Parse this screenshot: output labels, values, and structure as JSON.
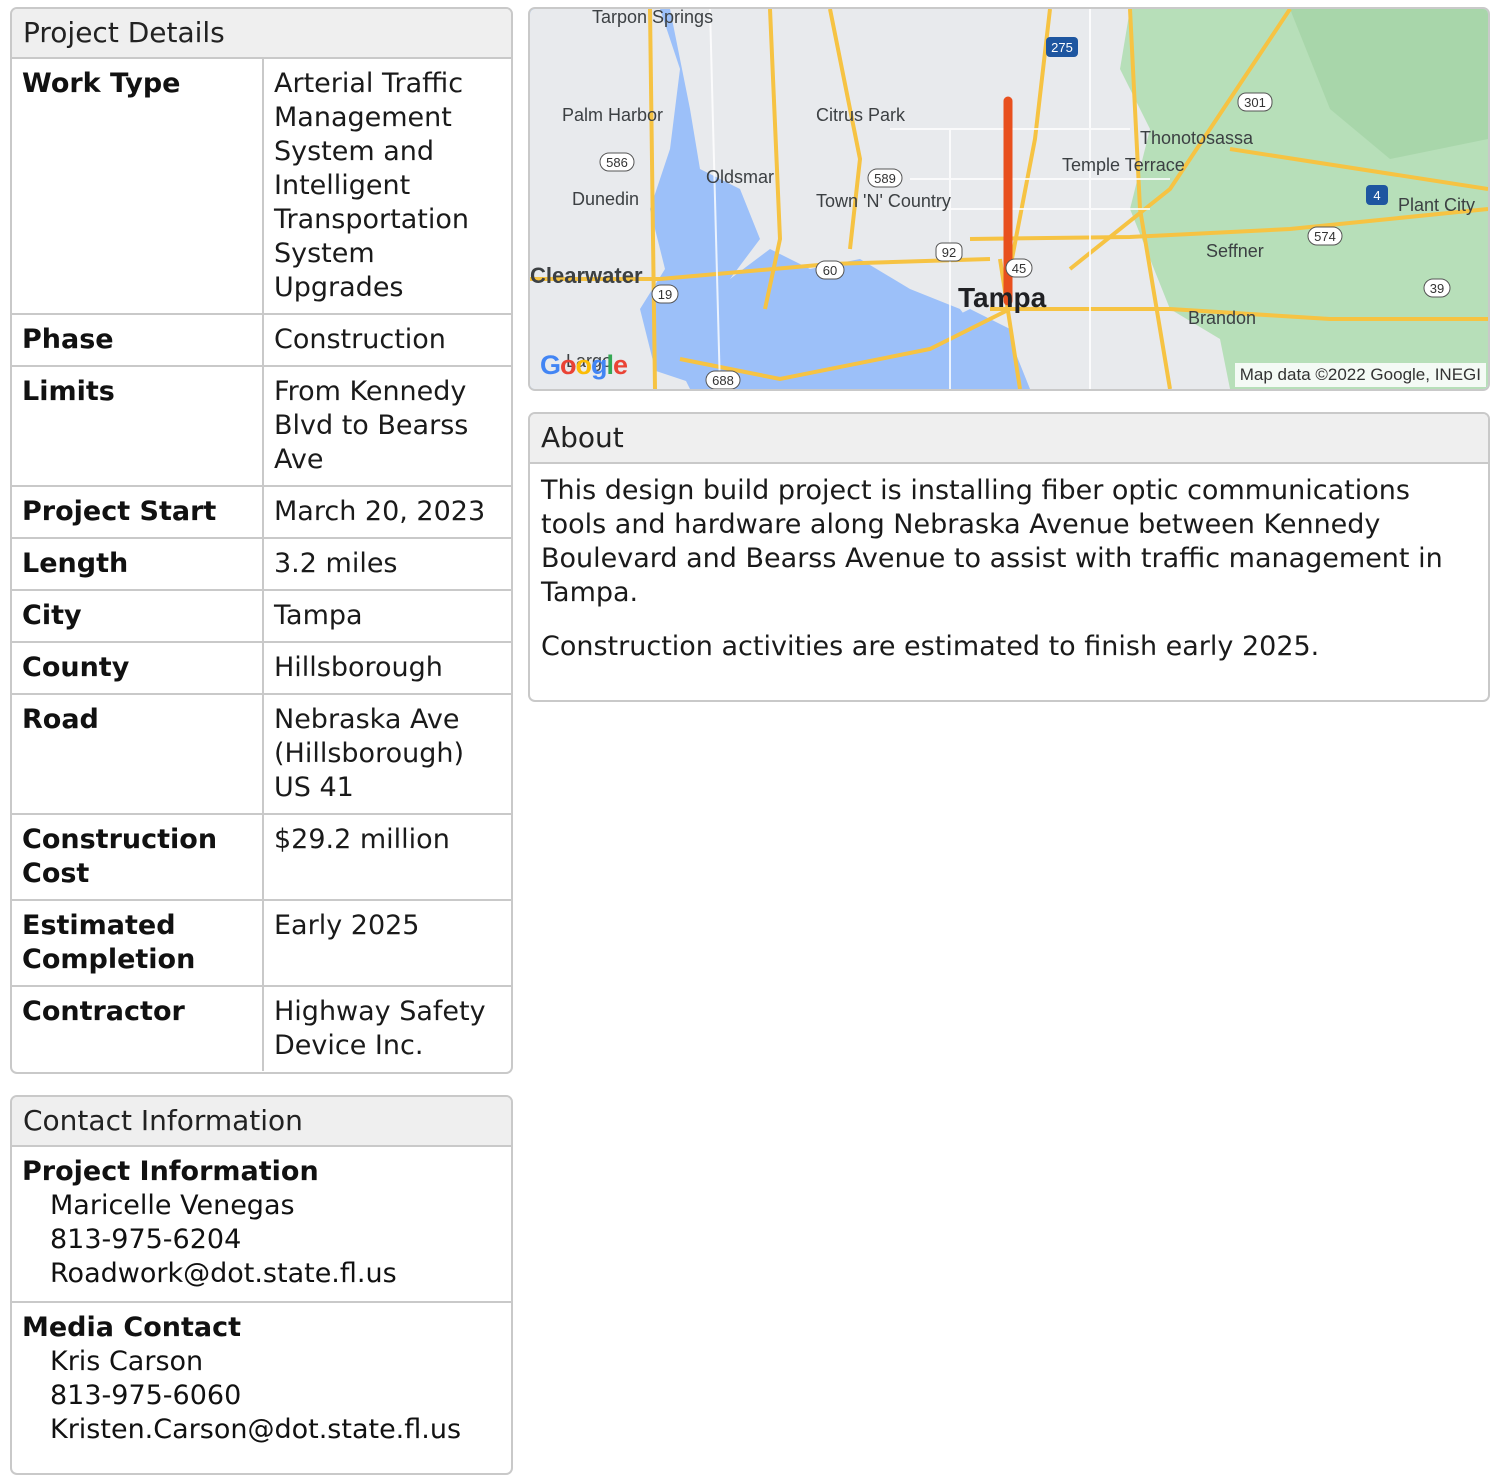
{
  "details": {
    "title": "Project Details",
    "rows": [
      {
        "label": "Work Type",
        "value": "Arterial Traffic Management System and Intelligent Transportation System Upgrades"
      },
      {
        "label": "Phase",
        "value": "Construction"
      },
      {
        "label": "Limits",
        "value": "From Kennedy Blvd to Bearss Ave"
      },
      {
        "label": "Project Start",
        "value": "March 20, 2023"
      },
      {
        "label": "Length",
        "value": "3.2 miles"
      },
      {
        "label": "City",
        "value": "Tampa"
      },
      {
        "label": "County",
        "value": "Hillsborough"
      },
      {
        "label": "Road",
        "value": "Nebraska Ave (Hillsborough) US 41"
      },
      {
        "label": "Construction Cost",
        "value": "$29.2 million"
      },
      {
        "label": "Estimated Completion",
        "value": "Early 2025"
      },
      {
        "label": "Contractor",
        "value": "Highway Safety Device Inc."
      }
    ]
  },
  "contact": {
    "title": "Contact Information",
    "blocks": [
      {
        "title": "Project Information",
        "name": "Maricelle Venegas",
        "phone": "813-975-6204",
        "email": "Roadwork@dot.state.fl.us"
      },
      {
        "title": "Media Contact",
        "name": "Kris Carson",
        "phone": "813-975-6060",
        "email": "Kristen.Carson@dot.state.fl.us"
      }
    ]
  },
  "map": {
    "attribution": "Map data ©2022 Google, INEGI",
    "logo": "Google",
    "places": [
      "Tarpon Springs",
      "Palm Harbor",
      "Citrus Park",
      "Thonotosassa",
      "Oldsmar",
      "Temple Terrace",
      "Dunedin",
      "Town 'N' Country",
      "Plant City",
      "Seffner",
      "Clearwater",
      "Tampa",
      "Brandon",
      "Largo"
    ],
    "shields": [
      "275",
      "301",
      "586",
      "589",
      "4",
      "574",
      "92",
      "60",
      "45",
      "19",
      "39",
      "688"
    ],
    "route_color": "#e8501e"
  },
  "about": {
    "title": "About",
    "paragraphs": [
      "This design build project is installing fiber optic communications tools and hardware along Nebraska Avenue between Kennedy Boulevard and Bearss Avenue to assist with traffic management in Tampa.",
      "Construction activities are estimated to finish early 2025."
    ]
  }
}
